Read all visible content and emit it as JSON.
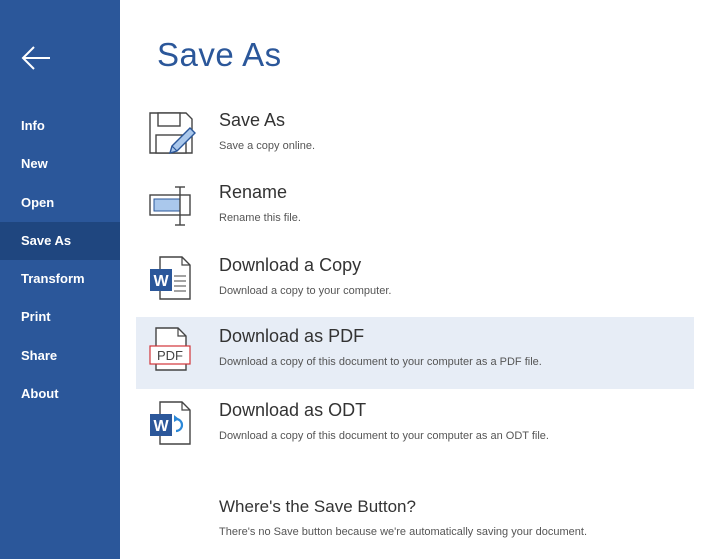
{
  "sidebar": {
    "items": [
      {
        "label": "Info"
      },
      {
        "label": "New"
      },
      {
        "label": "Open"
      },
      {
        "label": "Save As"
      },
      {
        "label": "Transform"
      },
      {
        "label": "Print"
      },
      {
        "label": "Share"
      },
      {
        "label": "About"
      }
    ],
    "active": "Save As"
  },
  "main": {
    "title": "Save As",
    "options": [
      {
        "title": "Save As",
        "desc": "Save a copy online.",
        "icon": "save-as-icon"
      },
      {
        "title": "Rename",
        "desc": "Rename this file.",
        "icon": "rename-icon"
      },
      {
        "title": "Download a Copy",
        "desc": "Download a copy to your computer.",
        "icon": "word-document-icon"
      },
      {
        "title": "Download as PDF",
        "desc": "Download a copy of this document to your computer as a PDF file.",
        "icon": "pdf-icon",
        "icon_text": "PDF"
      },
      {
        "title": "Download as ODT",
        "desc": "Download a copy of this document to your computer as an ODT file.",
        "icon": "odt-icon"
      }
    ],
    "help": {
      "title": "Where's the Save Button?",
      "desc": "There's no Save button because we're automatically saving your document."
    }
  },
  "colors": {
    "accent": "#2b579a",
    "sidebar_active": "#1f467f",
    "selected_row": "#e7edf6",
    "pdf_red": "#d13438"
  }
}
